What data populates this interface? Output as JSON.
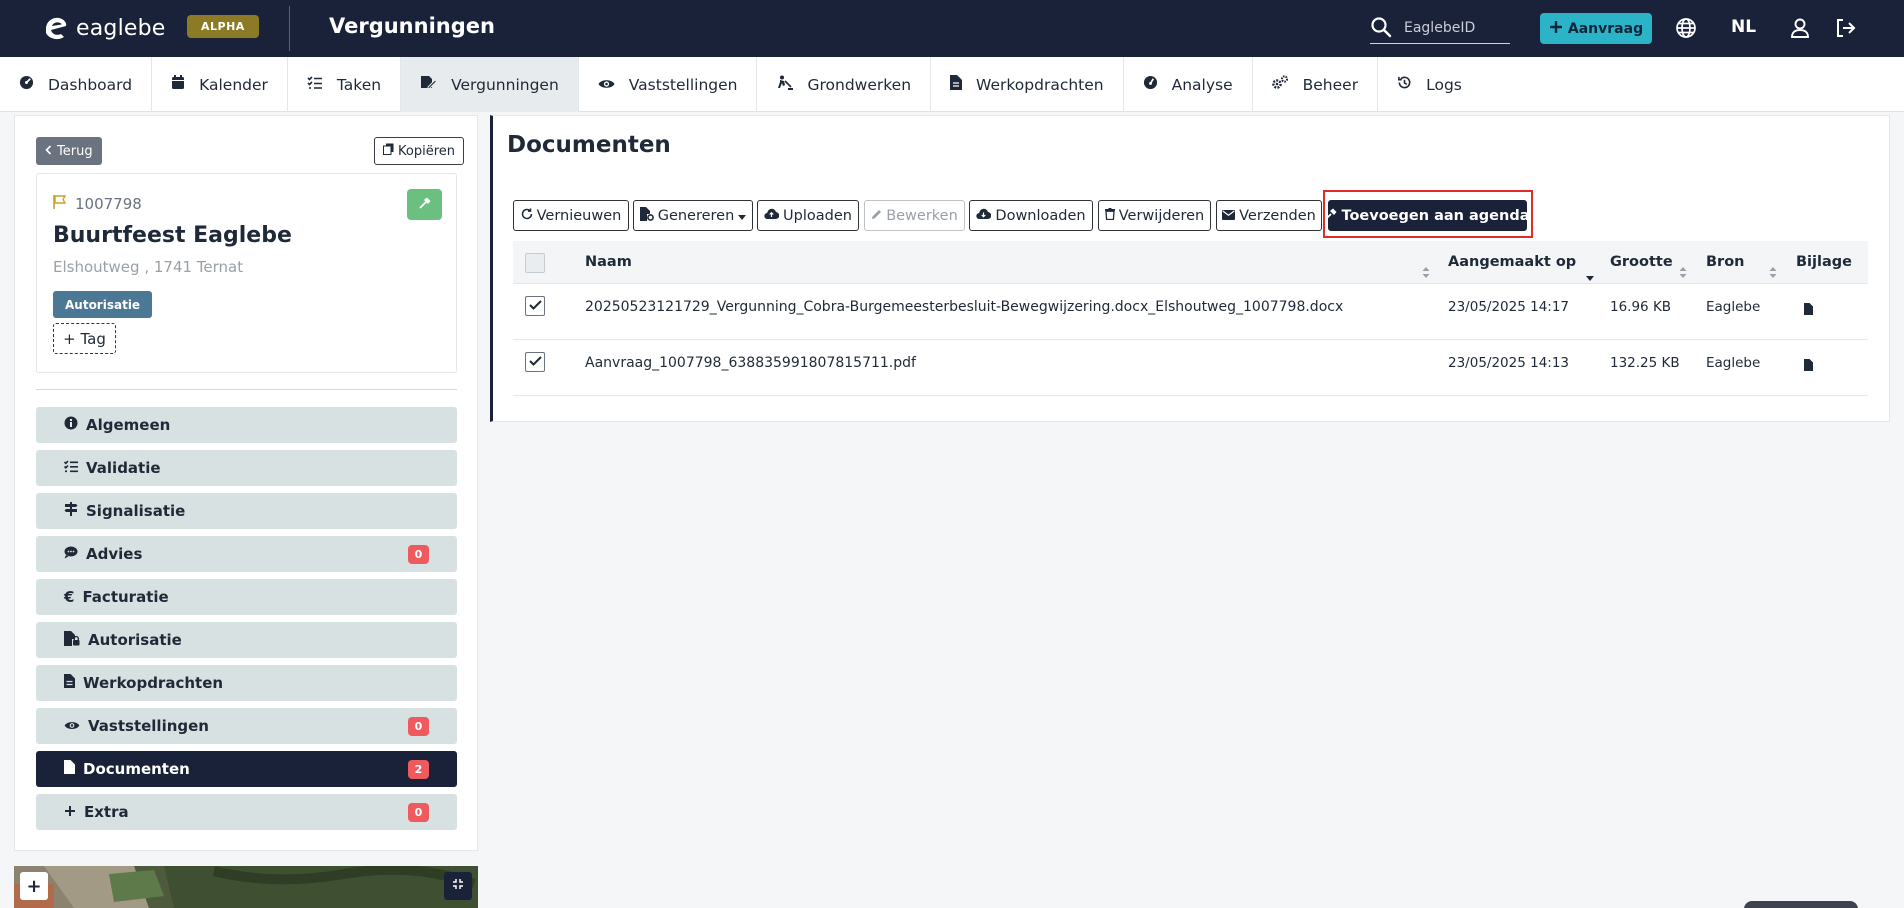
{
  "header": {
    "logo_text": "eaglebe",
    "badge": "ALPHA",
    "app_title": "Vergunningen",
    "search_placeholder": "EaglebeID",
    "aanvraag_label": "Aanvraag",
    "language": "NL"
  },
  "nav": {
    "items": [
      {
        "label": "Dashboard",
        "icon": "dashboard-icon"
      },
      {
        "label": "Kalender",
        "icon": "calendar-icon"
      },
      {
        "label": "Taken",
        "icon": "tasks-icon"
      },
      {
        "label": "Vergunningen",
        "icon": "permit-icon",
        "active": true
      },
      {
        "label": "Vaststellingen",
        "icon": "eye-icon"
      },
      {
        "label": "Grondwerken",
        "icon": "digging-icon"
      },
      {
        "label": "Werkopdrachten",
        "icon": "file-icon"
      },
      {
        "label": "Analyse",
        "icon": "gauge-icon"
      },
      {
        "label": "Beheer",
        "icon": "cogs-icon"
      },
      {
        "label": "Logs",
        "icon": "history-icon"
      }
    ]
  },
  "left": {
    "back_label": "Terug",
    "copy_label": "Kopiëren",
    "dossier_id": "1007798",
    "title": "Buurtfeest Eaglebe",
    "address": "Elshoutweg , 1741 Ternat",
    "status_tag": "Autorisatie",
    "add_tag_label": "+ Tag",
    "menu": [
      {
        "label": "Algemeen",
        "icon": "info-icon",
        "count": null
      },
      {
        "label": "Validatie",
        "icon": "checklist-icon",
        "count": null
      },
      {
        "label": "Signalisatie",
        "icon": "signpost-icon",
        "count": null
      },
      {
        "label": "Advies",
        "icon": "comments-icon",
        "count": "0"
      },
      {
        "label": "Facturatie",
        "icon": "euro-icon",
        "count": null
      },
      {
        "label": "Autorisatie",
        "icon": "file-lock-icon",
        "count": null
      },
      {
        "label": "Werkopdrachten",
        "icon": "file-icon",
        "count": null
      },
      {
        "label": "Vaststellingen",
        "icon": "eye-icon",
        "count": "0"
      },
      {
        "label": "Documenten",
        "icon": "file-icon",
        "count": "2",
        "active": true
      },
      {
        "label": "Extra",
        "icon": "plus-icon",
        "count": "0"
      }
    ]
  },
  "documents": {
    "title": "Documenten",
    "toolbar": {
      "refresh": "Vernieuwen",
      "generate": "Genereren",
      "upload": "Uploaden",
      "edit": "Bewerken",
      "download": "Downloaden",
      "delete": "Verwijderen",
      "send": "Verzenden",
      "add_agenda": "Toevoegen aan agenda"
    },
    "columns": {
      "name": "Naam",
      "created": "Aangemaakt op",
      "size": "Grootte",
      "source": "Bron",
      "attachment": "Bijlage"
    },
    "rows": [
      {
        "checked": true,
        "name": "20250523121729_Vergunning_Cobra-Burgemeesterbesluit-Bewegwijzering.docx_Elshoutweg_1007798.docx",
        "created": "23/05/2025 14:17",
        "size": "16.96 KB",
        "source": "Eaglebe"
      },
      {
        "checked": true,
        "name": "Aanvraag_1007798_638835991807815711.pdf",
        "created": "23/05/2025 14:13",
        "size": "132.25 KB",
        "source": "Eaglebe"
      }
    ]
  },
  "colors": {
    "brand_dark": "#1a2239",
    "accent": "#2bb3c8",
    "badge_gold": "#8c7a26",
    "menu_bg": "#d7e1e2",
    "count_red": "#ef5a5f",
    "highlight": "#e02b2b"
  }
}
